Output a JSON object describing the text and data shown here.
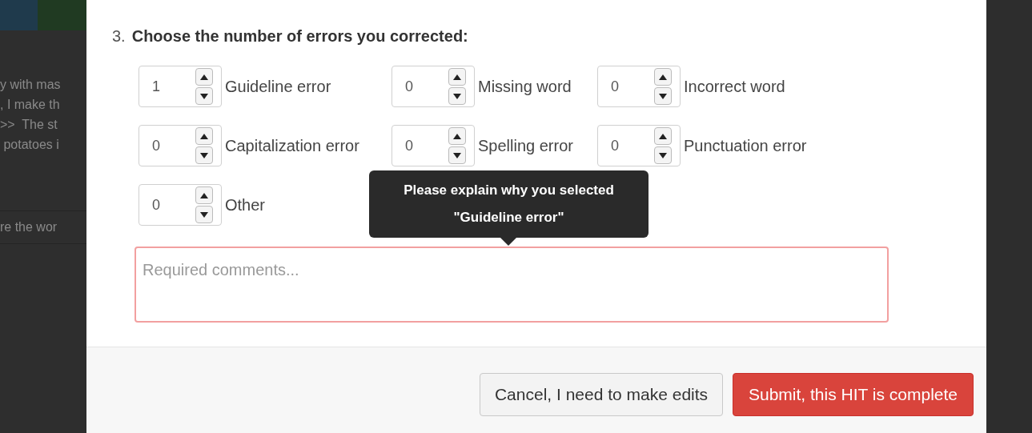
{
  "background_page": {
    "lines": [
      "y with mas",
      ", I make th",
      ">>  The st",
      " potatoes i"
    ],
    "footer_text": "re the wor"
  },
  "question": {
    "number": "3.",
    "title": "Choose the number of errors you corrected:"
  },
  "counters": [
    {
      "count": "1",
      "error_type": "Guideline error"
    },
    {
      "count": "0",
      "error_type": "Missing word"
    },
    {
      "count": "0",
      "error_type": "Incorrect word"
    },
    {
      "count": "0",
      "error_type": "Capitalization error"
    },
    {
      "count": "0",
      "error_type": "Spelling error"
    },
    {
      "count": "0",
      "error_type": "Punctuation error"
    },
    {
      "count": "0",
      "error_type": "Other"
    }
  ],
  "tooltip": {
    "lines": [
      "Please explain why you selected",
      "\"Guideline error\""
    ]
  },
  "comments": {
    "placeholder": "Required comments...",
    "invalid": true
  },
  "buttons": [
    {
      "kind": "secondary",
      "label": "Cancel, I need to make edits"
    },
    {
      "kind": "danger",
      "label": "Submit, this HIT is complete"
    }
  ]
}
